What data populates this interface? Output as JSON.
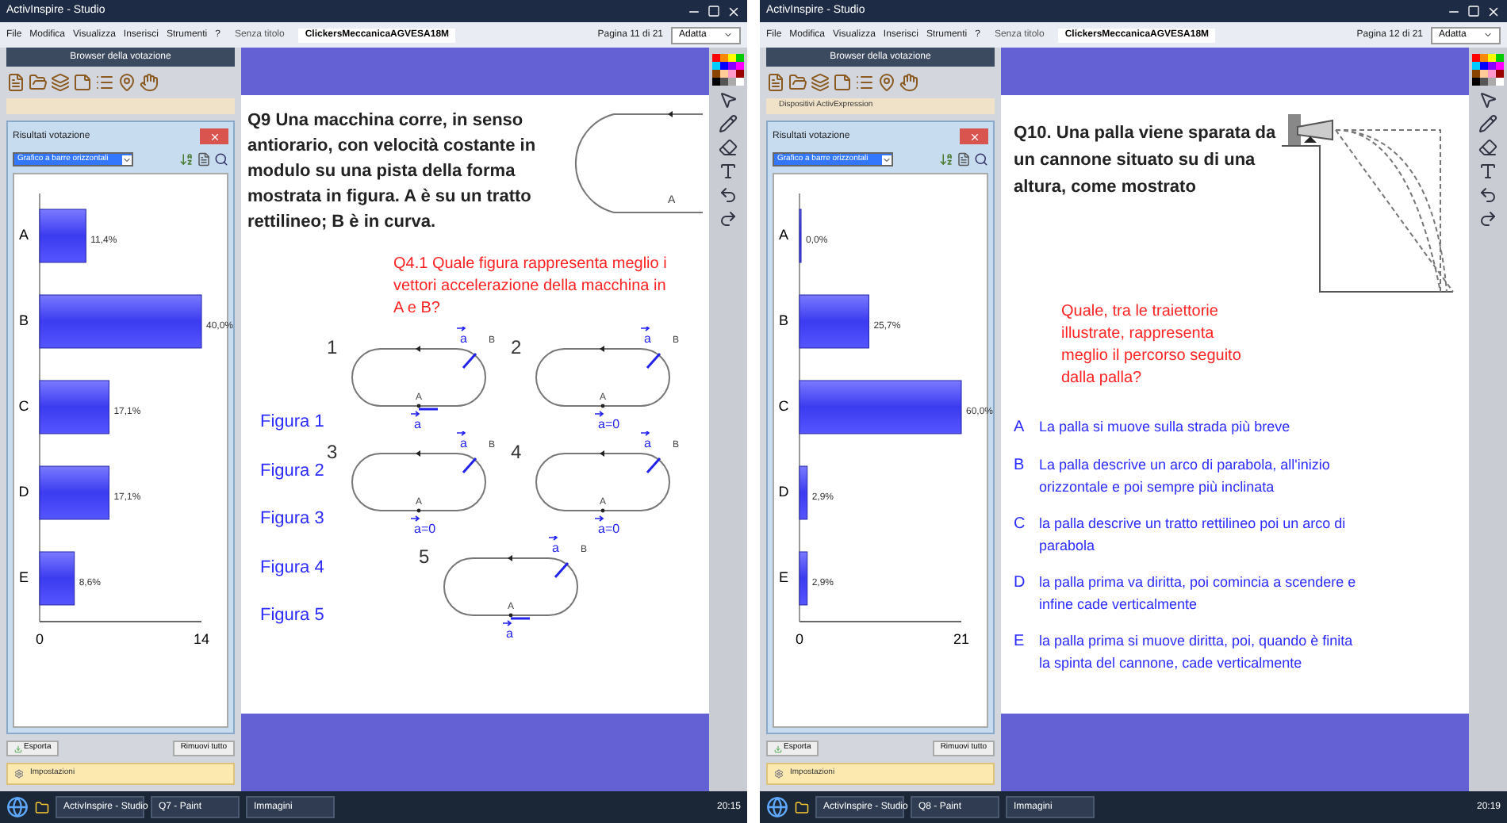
{
  "screens": [
    {
      "window": {
        "title": "ActivInspire - Studio"
      },
      "menu": [
        "File",
        "Modifica",
        "Visualizza",
        "Inserisci",
        "Strumenti",
        "?"
      ],
      "doc_tabs": [
        {
          "label": "Senza titolo",
          "selected": false
        },
        {
          "label": "ClickersMeccanicaAGVESA18M",
          "selected": true
        }
      ],
      "page_indicator": "Pagina 11 di 21",
      "zoom_select": "Adatta",
      "browser_panel": {
        "title": "Browser della votazione"
      },
      "results_window": {
        "title": "Risultati votazione",
        "chart_type": "Grafico a barre orizzontali",
        "chart_data": {
          "type": "bar",
          "orientation": "horizontal",
          "categories": [
            "A",
            "B",
            "C",
            "D",
            "E"
          ],
          "values": [
            4,
            14,
            6,
            6,
            3
          ],
          "xlim": [
            0,
            14
          ],
          "xticks": [
            0,
            14
          ]
        },
        "bar_labels": [
          "11,4%",
          "40,0%",
          "17,1%",
          "17,1%",
          "8,6%"
        ]
      },
      "buttons": [
        "Esporta",
        "Rimuovi tutto"
      ],
      "settings_bar": "Impostazioni",
      "slide": {
        "kind": "tracks",
        "question": "Q9 Una macchina corre, in senso antiorario, con velocità costante in modulo su una pista della forma mostrata in figura. A  è su un tratto rettilineo; B è in curva.",
        "intro_point": "A",
        "prompt": "Q4.1 Quale figura rappresenta meglio i vettori accelerazione della macchina in A e B?",
        "figures": [
          "Figura 1",
          "Figura 2",
          "Figura 3",
          "Figura 4",
          "Figura 5"
        ],
        "tracks": [
          {
            "number": "1",
            "point_a": "A",
            "point_b": "B",
            "vector_b": "a",
            "vector_a": "a",
            "arrow_at_a": true
          },
          {
            "number": "2",
            "point_a": "A",
            "point_b": "B",
            "vector_b": "a",
            "vector_a": "a=0",
            "arrow_at_a": false
          },
          {
            "number": "3",
            "point_a": "A",
            "point_b": "B",
            "vector_b": "a",
            "vector_a": "a=0",
            "arrow_at_a": false
          },
          {
            "number": "4",
            "point_a": "A",
            "point_b": "B",
            "vector_b": "a",
            "vector_a": "a=0",
            "arrow_at_a": false
          },
          {
            "number": "5",
            "point_a": "A",
            "point_b": "B",
            "vector_b": "a",
            "vector_a": "a",
            "arrow_at_a": true
          }
        ]
      },
      "taskbar": {
        "items": [
          "ActivInspire - Studio",
          "Q7 - Paint",
          "Immagini"
        ],
        "clock": "20:15"
      }
    },
    {
      "window": {
        "title": "ActivInspire - Studio"
      },
      "menu": [
        "File",
        "Modifica",
        "Visualizza",
        "Inserisci",
        "Strumenti",
        "?"
      ],
      "doc_tabs": [
        {
          "label": "Senza titolo",
          "selected": false
        },
        {
          "label": "ClickersMeccanicaAGVESA18M",
          "selected": true
        }
      ],
      "page_indicator": "Pagina 12 di 21",
      "zoom_select": "Adatta",
      "browser_panel": {
        "title": "Browser della votazione",
        "section": "Dispositivi ActivExpression"
      },
      "results_window": {
        "title": "Risultati votazione",
        "chart_type": "Grafico a barre orizzontali",
        "chart_data": {
          "type": "bar",
          "orientation": "horizontal",
          "categories": [
            "A",
            "B",
            "C",
            "D",
            "E"
          ],
          "values": [
            0,
            9,
            21,
            1,
            1
          ],
          "xlim": [
            0,
            21
          ],
          "xticks": [
            0,
            21
          ]
        },
        "bar_labels": [
          "0,0%",
          "25,7%",
          "60,0%",
          "2,9%",
          "2,9%"
        ]
      },
      "buttons": [
        "Esporta",
        "Rimuovi tutto"
      ],
      "settings_bar": "Impostazioni",
      "slide": {
        "kind": "cannon",
        "question": "Q10. Una palla viene sparata da un cannone situato su di una altura, come mostrato",
        "prompt": "Quale, tra le traiettorie illustrate, rappresenta meglio il percorso seguito dalla palla?",
        "options": [
          {
            "letter": "A",
            "text": "La palla si muove sulla strada più breve"
          },
          {
            "letter": "B",
            "text": "La palla descrive un arco di parabola, all'inizio orizzontale e poi sempre più inclinata"
          },
          {
            "letter": "C",
            "text": "la palla descrive un tratto rettilineo poi un arco di parabola"
          },
          {
            "letter": "D",
            "text": "la palla prima va diritta, poi comincia a scendere e infine cade verticalmente"
          },
          {
            "letter": "E",
            "text": "la palla prima si muove diritta, poi, quando è finita la spinta del cannone, cade verticalmente"
          }
        ]
      },
      "taskbar": {
        "items": [
          "ActivInspire - Studio",
          "Q8 - Paint",
          "Immagini"
        ],
        "clock": "20:19"
      }
    }
  ]
}
